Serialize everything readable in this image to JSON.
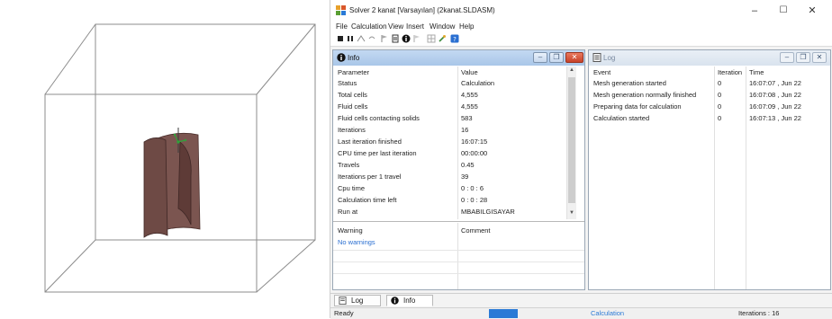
{
  "window": {
    "title": "Solver 2 kanat [Varsayılan] (2kanat.SLDASM)",
    "minimize": "–",
    "maximize": "☐",
    "close": "✕"
  },
  "menu": [
    "File",
    "Calculation",
    "View",
    "Insert",
    "Window",
    "Help"
  ],
  "toolbar_icons": [
    "stop-icon",
    "pause-icon",
    "insert-goal-icon",
    "undo-icon",
    "flag-icon",
    "document-icon",
    "info-icon",
    "flag-icon",
    "grid-icon",
    "tools-icon",
    "help-icon"
  ],
  "info_panel": {
    "title": "Info",
    "columns": [
      "Parameter",
      "Value"
    ],
    "rows": [
      {
        "param": "Status",
        "value": "Calculation"
      },
      {
        "param": "Total cells",
        "value": "4,555"
      },
      {
        "param": "Fluid cells",
        "value": "4,555"
      },
      {
        "param": "Fluid cells contacting solids",
        "value": "583"
      },
      {
        "param": "Iterations",
        "value": "16"
      },
      {
        "param": "Last iteration finished",
        "value": "16:07:15"
      },
      {
        "param": "CPU time per last iteration",
        "value": "00:00:00"
      },
      {
        "param": "Travels",
        "value": "0.45"
      },
      {
        "param": "Iterations per 1 travel",
        "value": "39"
      },
      {
        "param": "Cpu time",
        "value": "0 : 0 : 6"
      },
      {
        "param": "Calculation time left",
        "value": "0 : 0 : 28"
      },
      {
        "param": "Run at",
        "value": "MBABILGISAYAR"
      }
    ],
    "warning_columns": [
      "Warning",
      "Comment"
    ],
    "warnings": [
      "No warnings"
    ]
  },
  "log_panel": {
    "title": "Log",
    "columns": [
      "Event",
      "Iteration",
      "Time"
    ],
    "rows": [
      {
        "event": "Mesh generation started",
        "iteration": "0",
        "time": "16:07:07 , Jun 22"
      },
      {
        "event": "Mesh generation normally finished",
        "iteration": "0",
        "time": "16:07:08 , Jun 22"
      },
      {
        "event": "Preparing data for calculation",
        "iteration": "0",
        "time": "16:07:09 , Jun 22"
      },
      {
        "event": "Calculation started",
        "iteration": "0",
        "time": "16:07:13 , Jun 22"
      }
    ]
  },
  "bottom_tabs": [
    {
      "label": "Log",
      "icon": "log-icon"
    },
    {
      "label": "Info",
      "icon": "info-icon"
    }
  ],
  "status": {
    "ready": "Ready",
    "progress": 0.06,
    "mode": "Calculation",
    "iterations": "Iterations : 16"
  },
  "colors": {
    "accent": "#2a7ad6",
    "info_header": "#b7d0ee",
    "model_surface": "#6e4a45"
  }
}
